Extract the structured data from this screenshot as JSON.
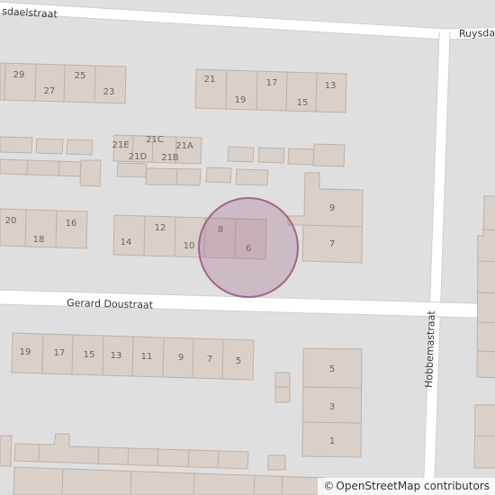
{
  "streets": {
    "top_left": "sdaelstraat",
    "top_right": "Ruysda",
    "gerard": "Gerard Doustraat",
    "hobbema": "Hobbemastraat"
  },
  "house_numbers": {
    "r1_29": "29",
    "r1_27": "27",
    "r1_25": "25",
    "r1_23": "23",
    "r1_21": "21",
    "r1_19": "19",
    "r1_17": "17",
    "r1_15": "15",
    "r1_13": "13",
    "c_21E": "21E",
    "c_21C": "21C",
    "c_21A": "21A",
    "c_21D": "21D",
    "c_21B": "21B",
    "r2_20": "20",
    "r2_18": "18",
    "r2_16": "16",
    "r2_14": "14",
    "r2_12": "12",
    "r2_10": "10",
    "r2_8": "8",
    "r2_6": "6",
    "r2_9": "9",
    "r2_7": "7",
    "s_19": "19",
    "s_17": "17",
    "s_15": "15",
    "s_13": "13",
    "s_11": "11",
    "s_9": "9",
    "s_7": "7",
    "s_5": "5",
    "e_5": "5",
    "e_3": "3",
    "e_1": "1"
  },
  "marker": {
    "color": "#a0668f"
  },
  "attribution": {
    "symbol": "©",
    "text": "OpenStreetMap contributors"
  }
}
